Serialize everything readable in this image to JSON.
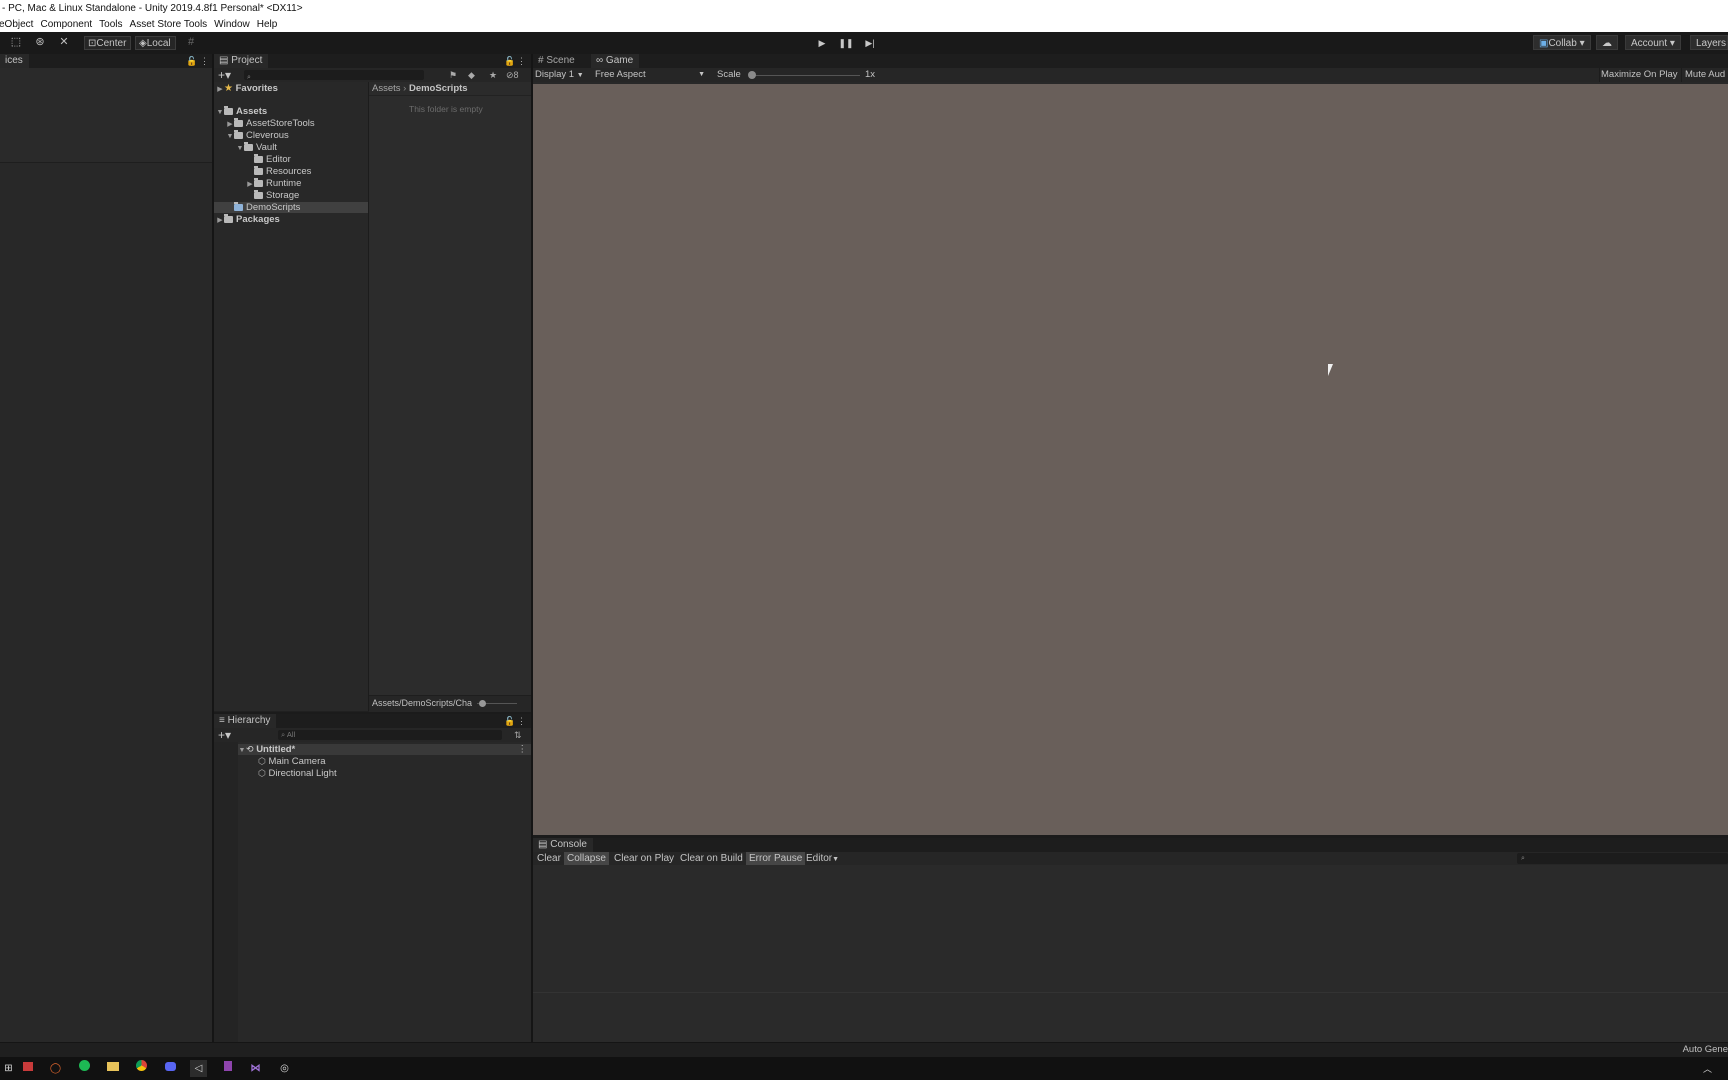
{
  "window": {
    "title": "- PC, Mac & Linux Standalone - Unity 2019.4.8f1 Personal* <DX11>"
  },
  "menu": [
    "eObject",
    "Component",
    "Tools",
    "Asset Store Tools",
    "Window",
    "Help"
  ],
  "toolbar": {
    "pivot": "Center",
    "space": "Local",
    "collab": "Collab",
    "account": "Account",
    "layers": "Layers"
  },
  "left_panel": {
    "tab": "ices"
  },
  "project": {
    "tab": "Project",
    "hidden_count": "8",
    "tree": {
      "favorites": "Favorites",
      "assets": "Assets",
      "asset_store_tools": "AssetStoreTools",
      "cleverous": "Cleverous",
      "vault": "Vault",
      "editor": "Editor",
      "resources": "Resources",
      "runtime": "Runtime",
      "storage": "Storage",
      "demo_scripts": "DemoScripts",
      "packages": "Packages"
    },
    "breadcrumb_root": "Assets",
    "breadcrumb_current": "DemoScripts",
    "empty_message": "This folder is empty",
    "footer_path": "Assets/DemoScripts/Cha"
  },
  "hierarchy": {
    "tab": "Hierarchy",
    "search_placeholder": "All",
    "scene": "Untitled*",
    "items": [
      "Main Camera",
      "Directional Light"
    ]
  },
  "game_view": {
    "tabs": {
      "scene": "Scene",
      "game": "Game"
    },
    "display": "Display 1",
    "aspect": "Free Aspect",
    "scale_label": "Scale",
    "scale_value": "1x",
    "maximize_on_play": "Maximize On Play",
    "mute_audio": "Mute Aud",
    "background_color": "#695f5a"
  },
  "console": {
    "tab": "Console",
    "buttons": {
      "clear": "Clear",
      "collapse": "Collapse",
      "clear_on_play": "Clear on Play",
      "clear_on_build": "Clear on Build",
      "error_pause": "Error Pause",
      "editor": "Editor"
    }
  },
  "status": {
    "right_text": "Auto Gene"
  },
  "taskbar": {
    "icons": [
      "windows-icon",
      "explorer-icon",
      "github-icon",
      "spotify-icon",
      "folder-icon",
      "chrome-icon",
      "discord-icon",
      "unity-icon",
      "notes-icon",
      "visual-studio-icon",
      "obs-icon"
    ]
  }
}
